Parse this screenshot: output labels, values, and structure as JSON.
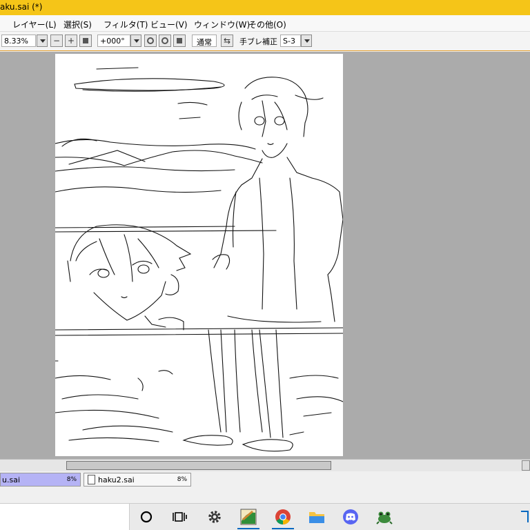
{
  "window": {
    "title": "aku.sai (*)"
  },
  "menu": [
    {
      "label": "レイヤー(L)"
    },
    {
      "label": "選択(S)"
    },
    {
      "label": "フィルタ(T)"
    },
    {
      "label": "ビュー(V)"
    },
    {
      "label": "ウィンドウ(W)"
    },
    {
      "label": "その他(O)"
    }
  ],
  "toolbar": {
    "zoom_value": "8.33%",
    "rotation_value": "+000°",
    "blend_mode": "通常",
    "stabilizer_label": "手ブレ補正",
    "stabilizer_value": "S-3"
  },
  "tabs": [
    {
      "name": "u.sai",
      "zoom": "8%"
    },
    {
      "name": "haku2.sai",
      "zoom": "8%"
    }
  ],
  "taskbar": {
    "icons": [
      "cortana-icon",
      "task-view-icon",
      "settings-icon",
      "paint-tool-sai-icon",
      "chrome-icon",
      "file-explorer-icon",
      "discord-icon",
      "frog-app-icon"
    ]
  },
  "colors": {
    "title_bar": "#f5c518",
    "active_tab": "#b5b3f5",
    "workspace": "#ababab",
    "accent_line": "#e09a2a"
  }
}
